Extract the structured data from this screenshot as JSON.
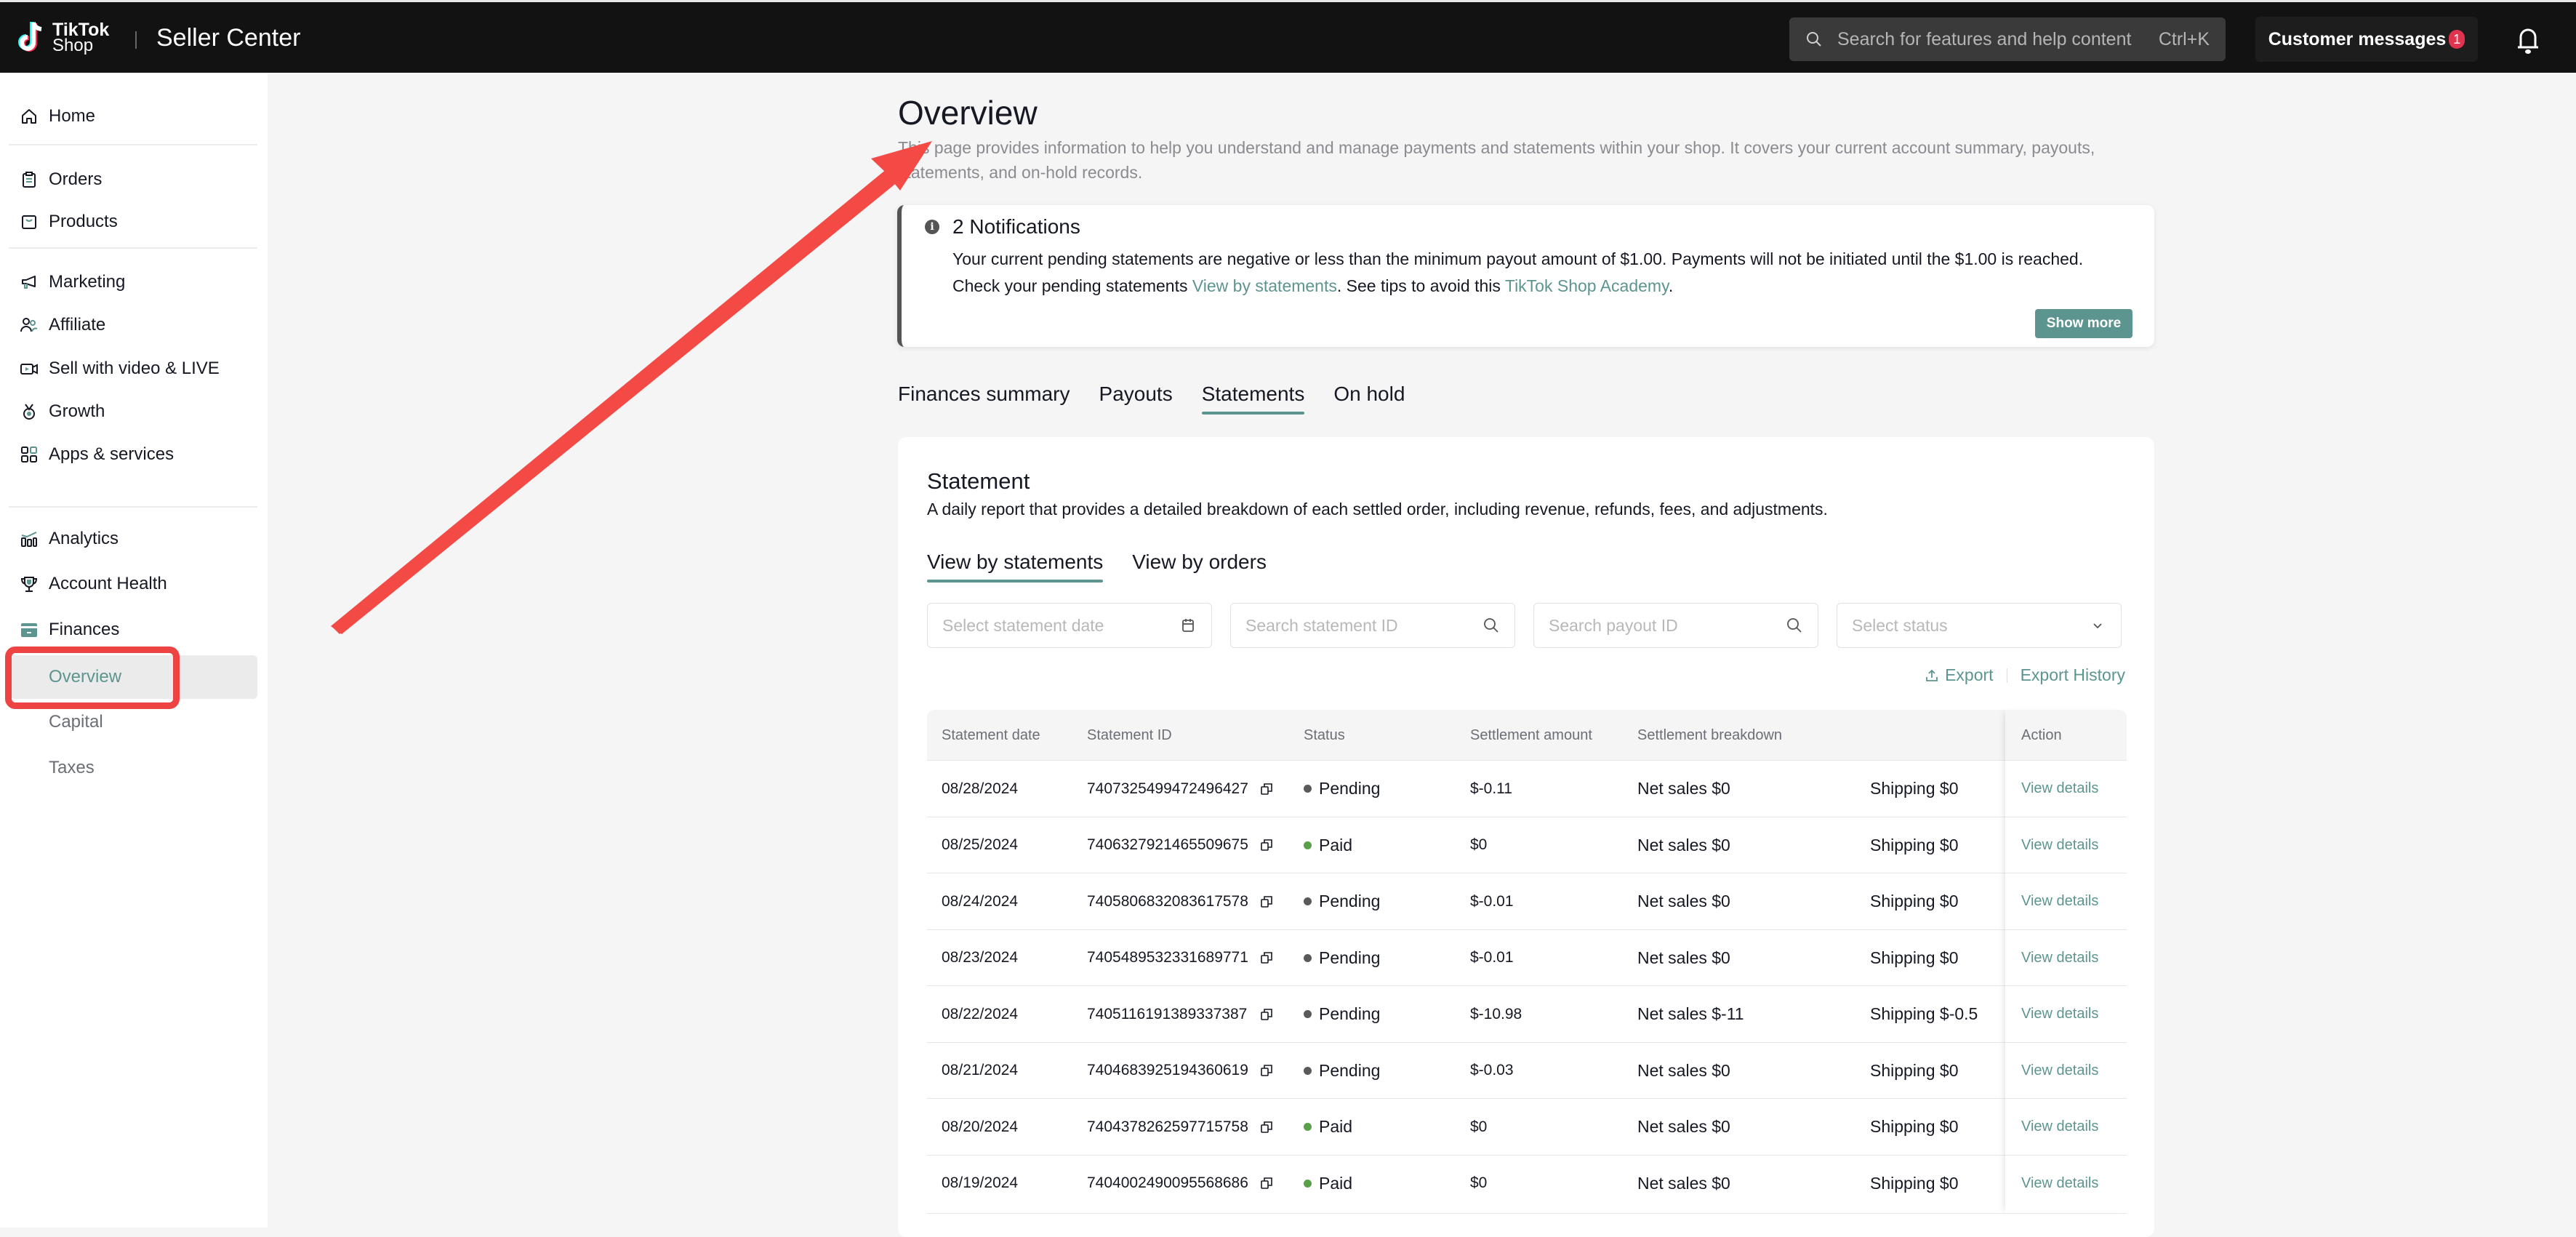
{
  "header": {
    "logo_line1": "TikTok",
    "logo_line2": "Shop",
    "app_title": "Seller Center",
    "search_placeholder": "Search for features and help content",
    "search_shortcut": "Ctrl+K",
    "customer_messages_label": "Customer messages",
    "customer_messages_badge": "1"
  },
  "sidebar": {
    "items": [
      {
        "label": "Home",
        "icon": "home-icon"
      },
      {
        "label": "Orders",
        "icon": "clipboard-icon"
      },
      {
        "label": "Products",
        "icon": "shopping-bag-icon"
      },
      {
        "label": "Marketing",
        "icon": "megaphone-icon"
      },
      {
        "label": "Affiliate",
        "icon": "users-icon"
      },
      {
        "label": "Sell with video & LIVE",
        "icon": "video-camera-icon"
      },
      {
        "label": "Growth",
        "icon": "medal-icon"
      },
      {
        "label": "Apps & services",
        "icon": "apps-grid-icon"
      },
      {
        "label": "Analytics",
        "icon": "bar-chart-icon"
      },
      {
        "label": "Account Health",
        "icon": "trophy-icon"
      },
      {
        "label": "Finances",
        "icon": "wallet-icon"
      }
    ],
    "finances_sub": [
      {
        "label": "Overview",
        "active": true
      },
      {
        "label": "Capital",
        "active": false
      },
      {
        "label": "Taxes",
        "active": false
      }
    ]
  },
  "page": {
    "title": "Overview",
    "description": "This page provides information to help you understand and manage payments and statements within your shop. It covers your current account summary, payouts, statements, and on-hold records."
  },
  "notification": {
    "title": "2 Notifications",
    "text_1": "Your current pending statements are negative or less than the minimum payout amount of $1.00. Payments will not be initiated until the $1.00 is reached. Check your pending statements ",
    "link_1": "View by statements",
    "text_2": ". See tips to avoid this ",
    "link_2": "TikTok Shop Academy",
    "text_3": ".",
    "show_more_label": "Show more"
  },
  "tabs": [
    {
      "label": "Finances summary",
      "active": false
    },
    {
      "label": "Payouts",
      "active": false
    },
    {
      "label": "Statements",
      "active": true
    },
    {
      "label": "On hold",
      "active": false
    }
  ],
  "statement": {
    "title": "Statement",
    "description": "A daily report that provides a detailed breakdown of each settled order, including revenue, refunds, fees, and adjustments.",
    "subtabs": [
      {
        "label": "View by statements",
        "active": true
      },
      {
        "label": "View by orders",
        "active": false
      }
    ],
    "filters": {
      "date_placeholder": "Select statement date",
      "statement_id_placeholder": "Search statement ID",
      "payout_id_placeholder": "Search payout ID",
      "status_placeholder": "Select status"
    },
    "export_label": "Export",
    "export_history_label": "Export History",
    "columns": [
      "Statement date",
      "Statement ID",
      "Status",
      "Settlement amount",
      "Settlement breakdown",
      "",
      "Action"
    ],
    "rows": [
      {
        "date": "08/28/2024",
        "id": "7407325499472496427",
        "status": "Pending",
        "amount": "$-0.11",
        "net_sales": "Net sales $0",
        "shipping": "Shipping $0",
        "action": "View details"
      },
      {
        "date": "08/25/2024",
        "id": "7406327921465509675",
        "status": "Paid",
        "amount": "$0",
        "net_sales": "Net sales $0",
        "shipping": "Shipping $0",
        "action": "View details"
      },
      {
        "date": "08/24/2024",
        "id": "7405806832083617578",
        "status": "Pending",
        "amount": "$-0.01",
        "net_sales": "Net sales $0",
        "shipping": "Shipping $0",
        "action": "View details"
      },
      {
        "date": "08/23/2024",
        "id": "7405489532331689771",
        "status": "Pending",
        "amount": "$-0.01",
        "net_sales": "Net sales $0",
        "shipping": "Shipping $0",
        "action": "View details"
      },
      {
        "date": "08/22/2024",
        "id": "7405116191389337387",
        "status": "Pending",
        "amount": "$-10.98",
        "net_sales": "Net sales $-11",
        "shipping": "Shipping $-0.5",
        "action": "View details"
      },
      {
        "date": "08/21/2024",
        "id": "7404683925194360619",
        "status": "Pending",
        "amount": "$-0.03",
        "net_sales": "Net sales $0",
        "shipping": "Shipping $0",
        "action": "View details"
      },
      {
        "date": "08/20/2024",
        "id": "7404378262597715758",
        "status": "Paid",
        "amount": "$0",
        "net_sales": "Net sales $0",
        "shipping": "Shipping $0",
        "action": "View details"
      },
      {
        "date": "08/19/2024",
        "id": "7404002490095568686",
        "status": "Paid",
        "amount": "$0",
        "net_sales": "Net sales $0",
        "shipping": "Shipping $0",
        "action": "View details"
      }
    ]
  },
  "colors": {
    "accent": "#5c9590",
    "topbar": "#121212",
    "pending_dot": "#5a5a5a",
    "paid_dot": "#5aa04a",
    "annotation_red": "#ee4343"
  }
}
